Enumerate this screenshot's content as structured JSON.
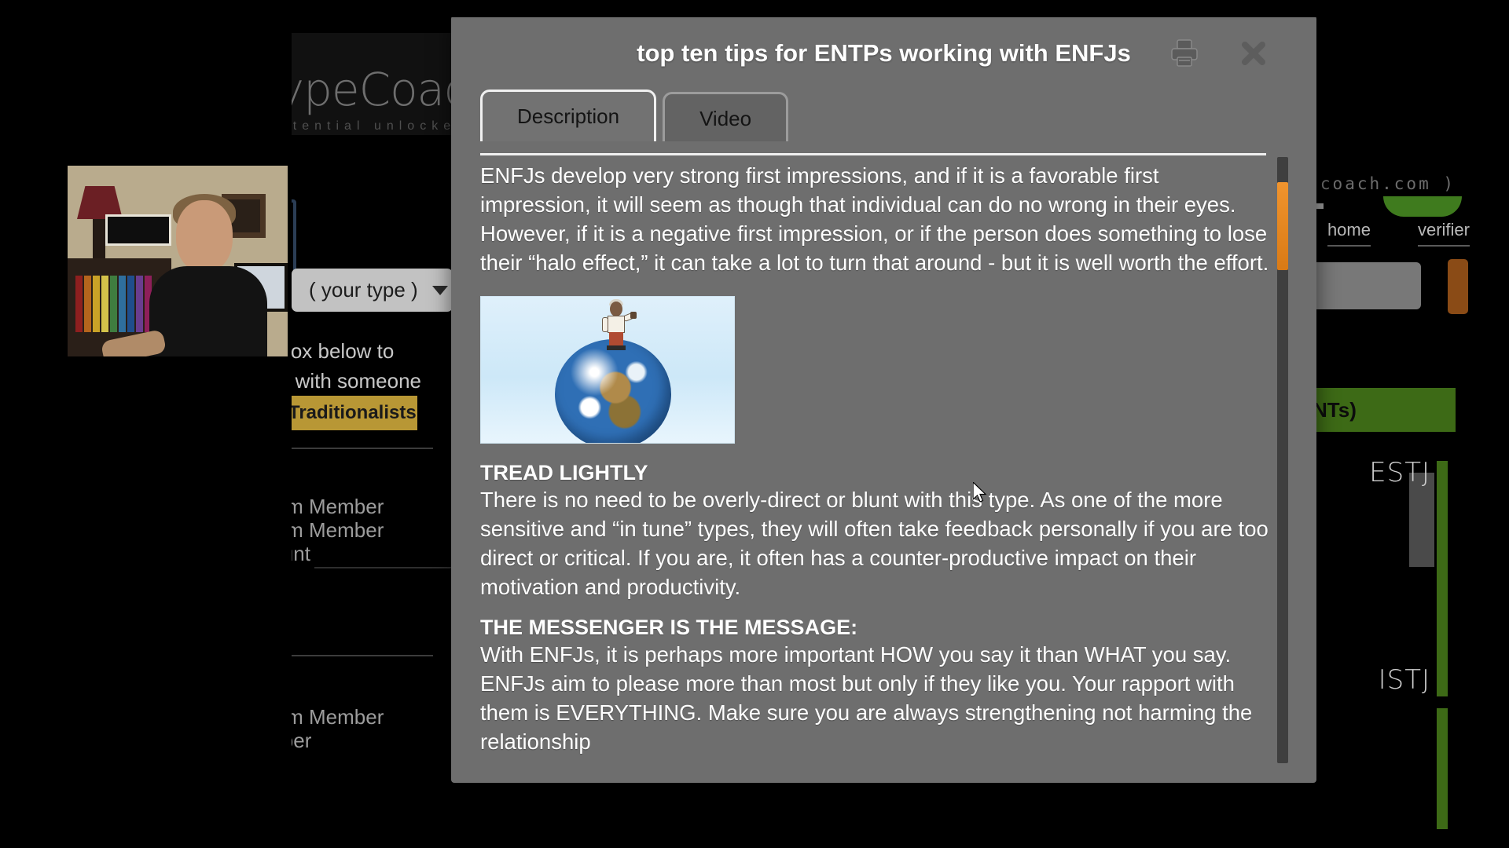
{
  "background_page": {
    "logo_word": "typeCoach",
    "logo_tagline": "potential unlocked",
    "url_text": "type-coach.com )",
    "nav": [
      "home",
      "verifier"
    ],
    "type_selector_label": "( your type )",
    "instructions_line1": "type box below to",
    "instructions_line2": "t work with someone",
    "gold_band_label": "Traditionalists",
    "green_band_label": "NTs)",
    "type_sections": [
      {
        "code": "ESTJ",
        "lines": [
          "e Team Member",
          "e Team Member",
          "Account"
        ]
      },
      {
        "code": "ISTJ",
        "lines": [
          "e Team Member",
          "Member"
        ]
      }
    ]
  },
  "modal": {
    "title": "top ten tips for ENTPs working with ENFJs",
    "print_icon": "printer-icon",
    "close_icon": "close-icon",
    "tabs": [
      {
        "label": "Description",
        "active": true
      },
      {
        "label": "Video",
        "active": false
      }
    ],
    "body": {
      "intro": "ENFJs develop very strong first impressions, and if it is a favorable first impression, it will seem as though that individual can do no wrong in their eyes. However, if it is a negative first impression, or if the person does something to lose their “halo effect,” it can take a lot to turn that around - but it is well worth the effort.",
      "hero_image_alt": "cartoon person standing on top of planet earth",
      "sections": [
        {
          "heading": "TREAD LIGHTLY",
          "text": "There is no need to be overly-direct or blunt with this type. As one of the more sensitive and “in tune” types, they will often take feedback personally if you are too direct or critical. If you are, it often has a counter-productive impact on their motivation and productivity."
        },
        {
          "heading": "THE MESSENGER IS THE MESSAGE:",
          "text": "With ENFJs, it is perhaps more important HOW you say it than WHAT you say. ENFJs aim to please more than most but only if they like you. Your rapport with them is EVERYTHING. Make sure you are always strengthening not harming the relationship"
        }
      ]
    },
    "scrollbar": {
      "thumb_color": "#e8881f",
      "track_color": "#3f3f3f"
    }
  },
  "webcam": {
    "description": "presenter webcam video feed"
  },
  "colors": {
    "modal_background": "#6e6e6e",
    "accent_orange": "#e8881f",
    "gold_band": "#b89735",
    "green_band": "#3d6a16",
    "page_background": "#000000"
  }
}
